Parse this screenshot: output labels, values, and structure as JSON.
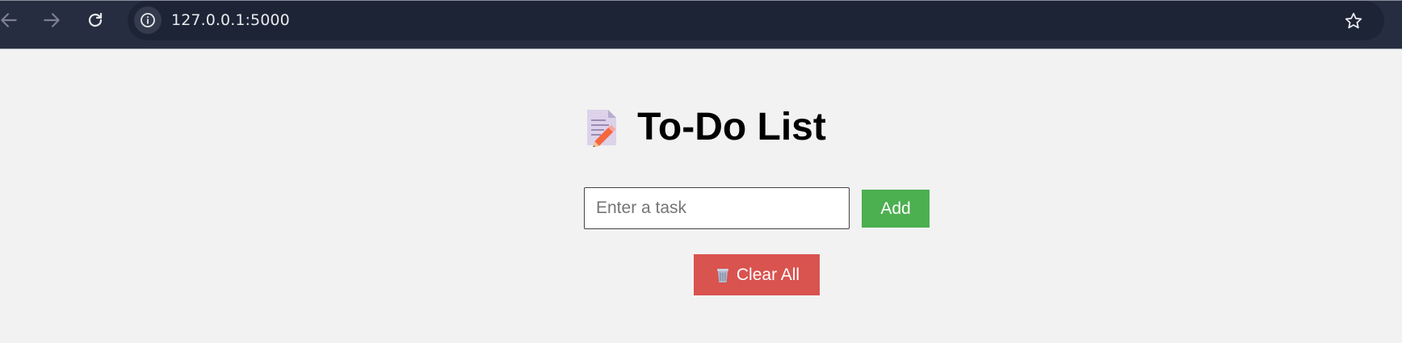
{
  "browser": {
    "url": "127.0.0.1:5000",
    "icons": {
      "back": "arrow-left-icon",
      "forward": "arrow-right-icon",
      "reload": "reload-icon",
      "site_info": "info-icon",
      "bookmark": "star-icon"
    }
  },
  "page": {
    "title": "To-Do List",
    "title_icon": "memo-icon",
    "task_input": {
      "placeholder": "Enter a task",
      "value": ""
    },
    "add_label": "Add",
    "clear_label": "Clear All",
    "clear_icon": "wastebasket-icon"
  },
  "colors": {
    "browser_bar": "#262d40",
    "omnibox": "#1d2436",
    "page_background": "#f2f2f2",
    "add_button": "#4caf50",
    "clear_button": "#d9534f"
  }
}
